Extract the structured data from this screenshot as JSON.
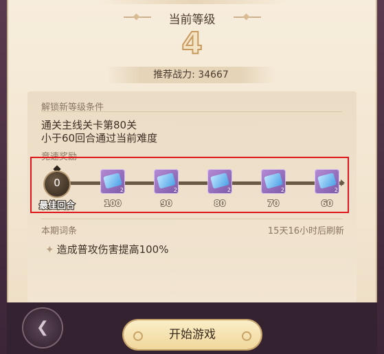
{
  "header": {
    "title": "当前等级",
    "level": "4",
    "recommended_power": "推荐战力: 34667"
  },
  "unlock": {
    "label": "解锁新等级条件",
    "conditions": [
      "通关主线关卡第80关",
      "小于60回合通过当前难度"
    ]
  },
  "speed_reward": {
    "label": "竞速奖励",
    "best_round_value": "0",
    "best_round_label": "最佳回合",
    "rewards": [
      {
        "qty": "2",
        "threshold": "100"
      },
      {
        "qty": "2",
        "threshold": "90"
      },
      {
        "qty": "2",
        "threshold": "80"
      },
      {
        "qty": "2",
        "threshold": "70"
      },
      {
        "qty": "2",
        "threshold": "60"
      }
    ]
  },
  "term": {
    "label": "本期词条",
    "refresh": "15天16小时后刷新",
    "effect": "造成普攻伤害提高100%"
  },
  "footer": {
    "start_label": "开始游戏"
  },
  "colors": {
    "accent_red_outline": "#e0151b",
    "panel_bg": "#f3e6d1",
    "start_button": "#f0d79b"
  }
}
